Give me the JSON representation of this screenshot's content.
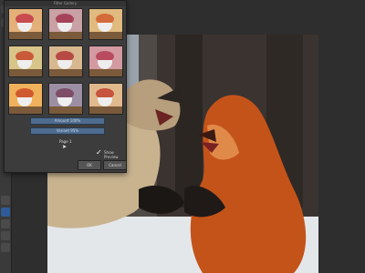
{
  "dialog": {
    "title": "Filter Gallery",
    "slider1_label": "Amount 100%",
    "slider2_label": "Variant 95%",
    "page_label": "Page 1",
    "preview_label": "Show Preview",
    "ok_label": "OK",
    "cancel_label": "Cancel"
  },
  "thumbnails": [
    {
      "tint": "#e3b07a",
      "flowers": "#c94a4f"
    },
    {
      "tint": "#c9a0a4",
      "flowers": "#a6435b"
    },
    {
      "tint": "#e0ba7e",
      "flowers": "#d46b3b"
    },
    {
      "tint": "#d9c58a",
      "flowers": "#c85a3a"
    },
    {
      "tint": "#d8b88f",
      "flowers": "#b84a45"
    },
    {
      "tint": "#d39aa2",
      "flowers": "#b84b5f"
    },
    {
      "tint": "#f0b15c",
      "flowers": "#d05a2f"
    },
    {
      "tint": "#9d8fa3",
      "flowers": "#7e4d68"
    },
    {
      "tint": "#e0b98d",
      "flowers": "#c7543e"
    }
  ],
  "icons": {
    "cursor": "arrow-cursor-icon",
    "check": "checkmark-icon"
  }
}
